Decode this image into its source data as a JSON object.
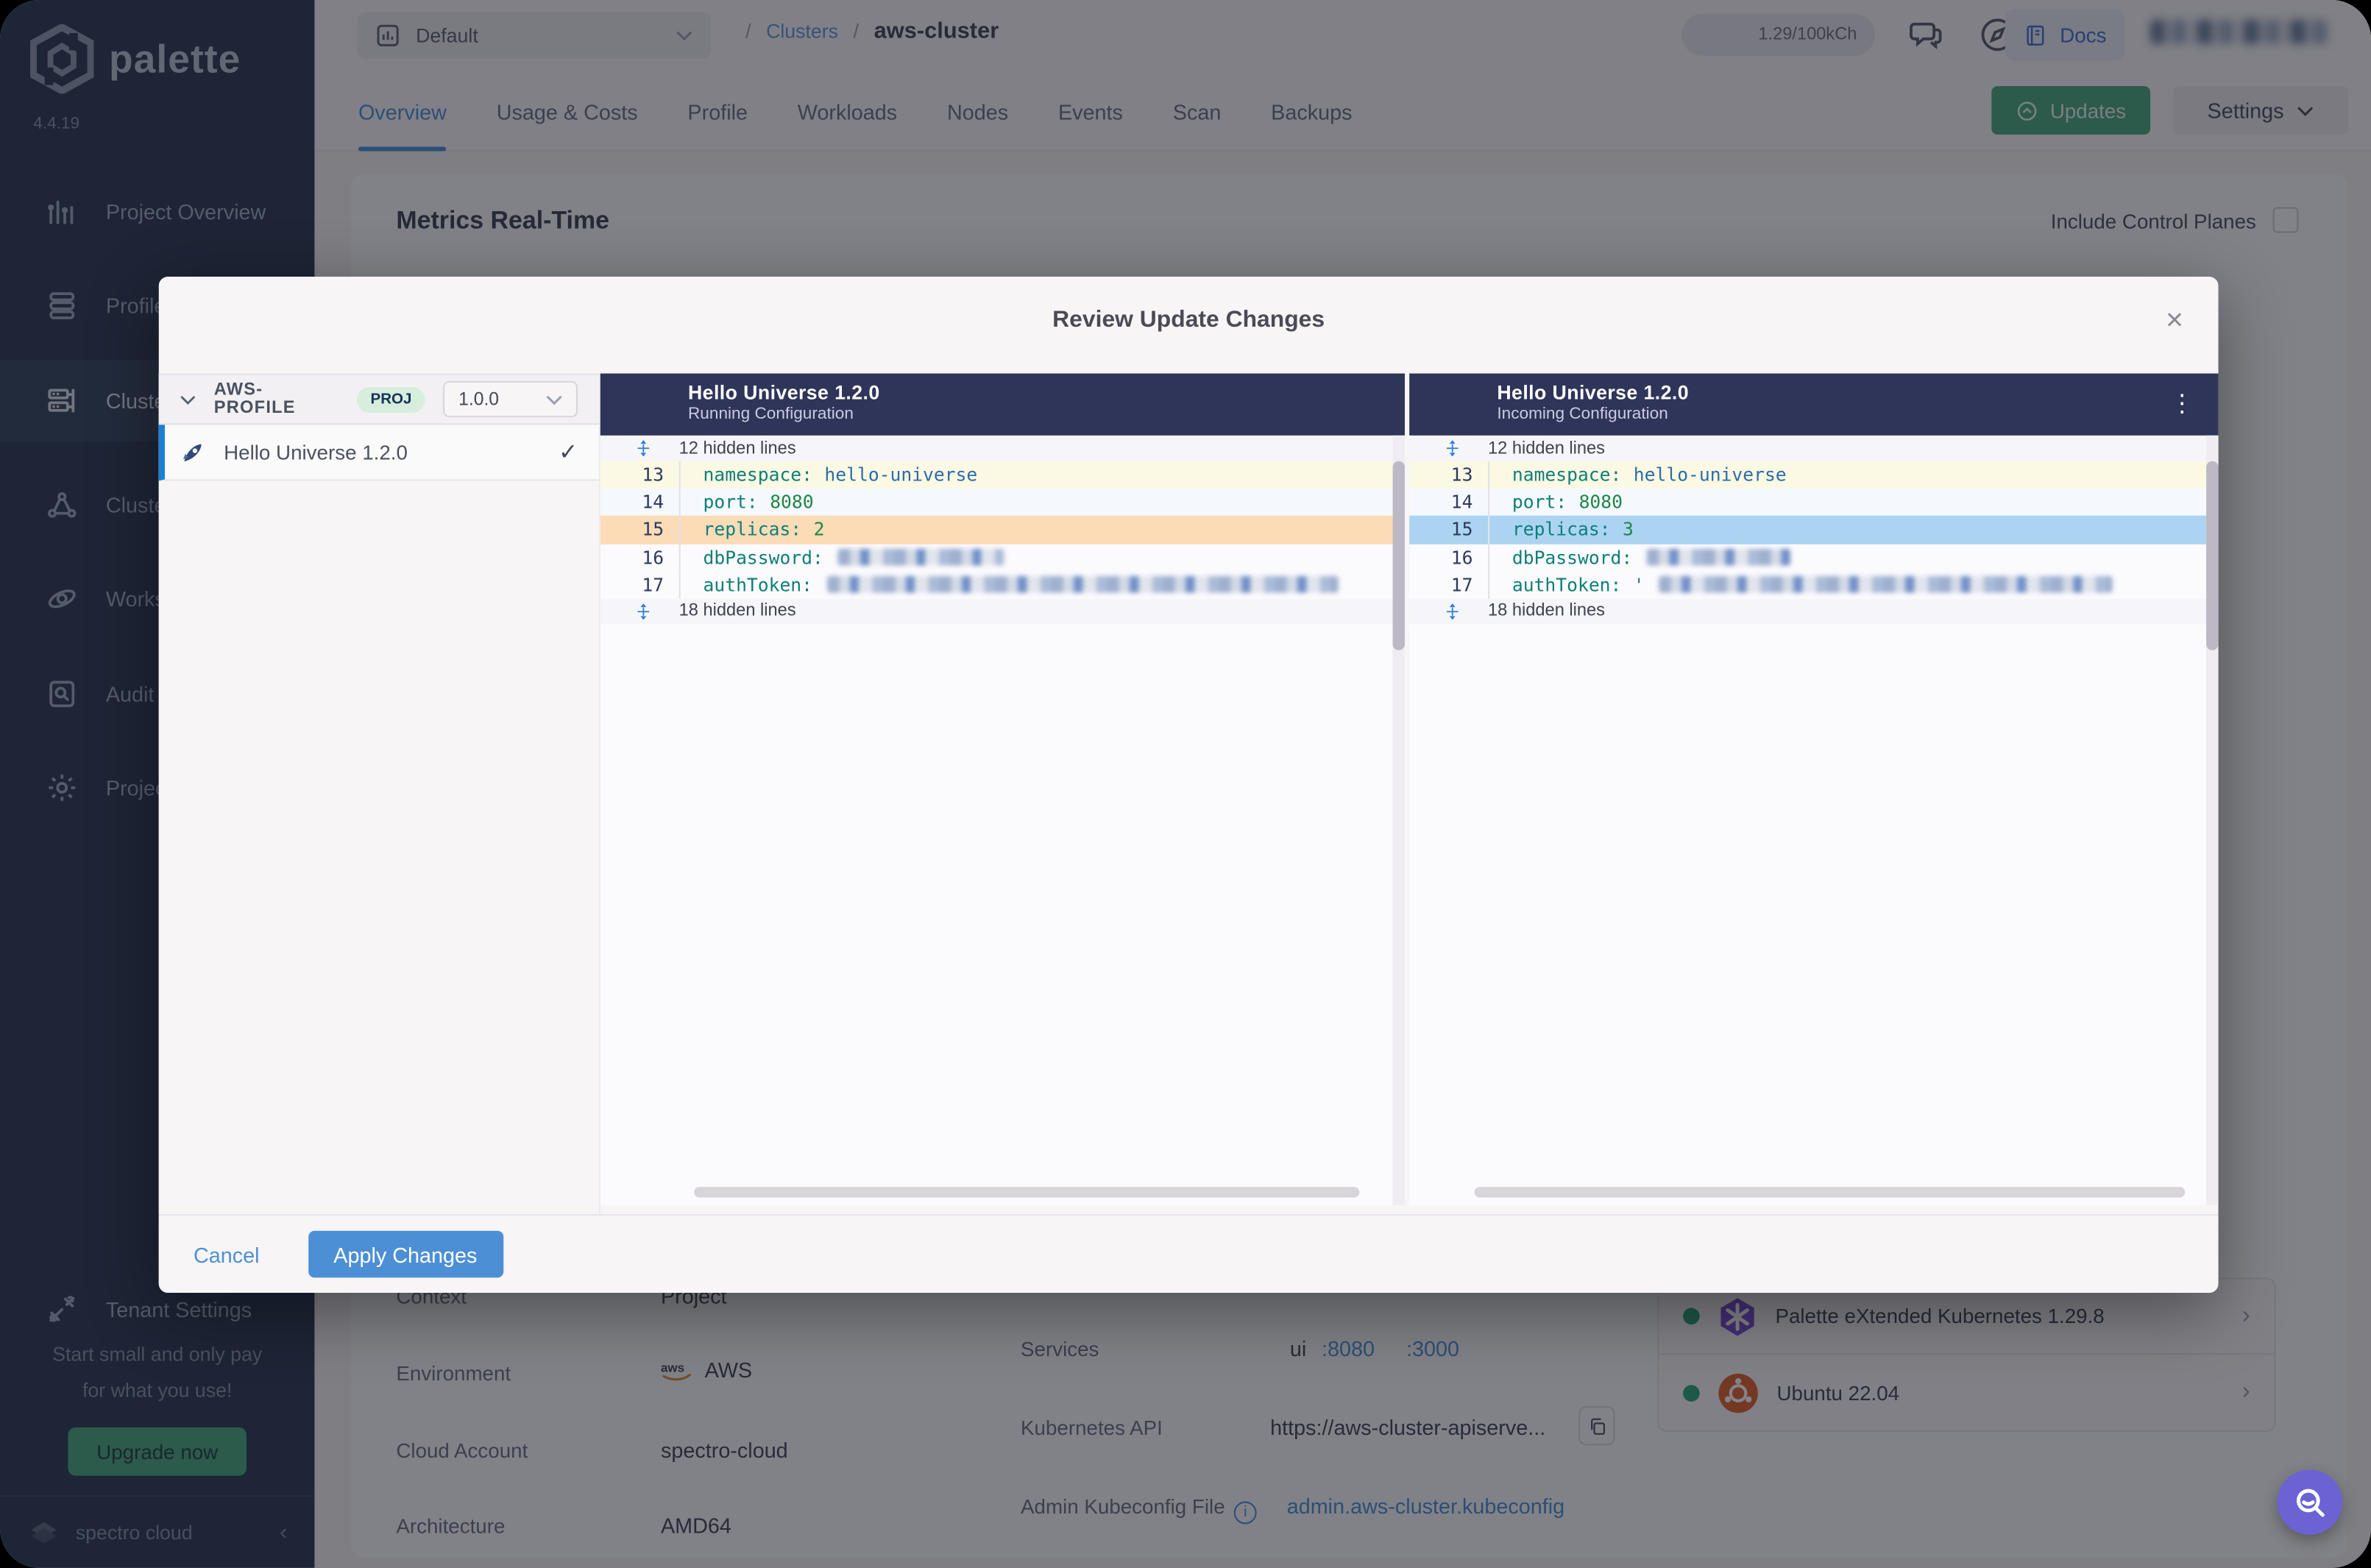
{
  "icons": {
    "close": "×",
    "check": "✓",
    "kebab": "⋮",
    "slash": "/",
    "collapse": "‹",
    "chevron_right": "›",
    "info": "i"
  },
  "colors": {
    "accent_blue": "#4d8fd5",
    "green": "#4aa87d",
    "diff_header_navy": "#2f3459",
    "changed_left": "#fbdcb7",
    "changed_right": "#abd4f2",
    "status_green": "#2ba577",
    "fab_purple": "#6b63d3"
  },
  "app": {
    "brand": "palette",
    "version": "4.4.19",
    "footer_brand": "spectro cloud"
  },
  "topbar": {
    "project_selector": "Default",
    "breadcrumb_section": "Clusters",
    "breadcrumb_current": "aws-cluster",
    "usage_badge": "1.29/100kCh",
    "docs_label": "Docs"
  },
  "tabs": [
    {
      "label": "Overview"
    },
    {
      "label": "Usage & Costs"
    },
    {
      "label": "Profile"
    },
    {
      "label": "Workloads"
    },
    {
      "label": "Nodes"
    },
    {
      "label": "Events"
    },
    {
      "label": "Scan"
    },
    {
      "label": "Backups"
    }
  ],
  "actions": {
    "updates": "Updates",
    "settings": "Settings"
  },
  "sidebar": {
    "items": [
      {
        "label": "Project Overview"
      },
      {
        "label": "Profiles"
      },
      {
        "label": "Clusters"
      },
      {
        "label": "Cluster Groups"
      },
      {
        "label": "Workspaces"
      },
      {
        "label": "Audit Logs"
      },
      {
        "label": "Project Settings"
      },
      {
        "label": "Tenant Settings"
      }
    ],
    "promo_line1": "Start small and only pay",
    "promo_line2": "for what you use!",
    "upgrade_label": "Upgrade now"
  },
  "main": {
    "metrics_title": "Metrics Real-Time",
    "include_control_planes": "Include Control Planes",
    "details": [
      {
        "label": "Context",
        "value": "Project"
      },
      {
        "label": "Environment",
        "value": "AWS"
      },
      {
        "label": "Cloud Account",
        "value": "spectro-cloud"
      },
      {
        "label": "Architecture",
        "value": "AMD64"
      }
    ],
    "services": {
      "label": "Services",
      "name": "ui",
      "port1": ":8080",
      "port2": ":3000"
    },
    "kubernetes_api": {
      "label": "Kubernetes API",
      "value": "https://aws-cluster-apiserve..."
    },
    "kubeconfig": {
      "label": "Admin Kubeconfig File",
      "value": "admin.aws-cluster.kubeconfig"
    },
    "layers": [
      {
        "name": "Palette eXtended Kubernetes 1.29.8"
      },
      {
        "name": "Ubuntu 22.04"
      }
    ]
  },
  "modal": {
    "title": "Review Update Changes",
    "profile": {
      "name": "AWS-PROFILE",
      "scope": "PROJ",
      "version": "1.0.0",
      "pack_name": "Hello Universe 1.2.0"
    },
    "diff": {
      "left_title": "Hello Universe 1.2.0",
      "left_subtitle": "Running Configuration",
      "right_title": "Hello Universe 1.2.0",
      "right_subtitle": "Incoming Configuration",
      "hidden_top": "12 hidden lines",
      "hidden_bottom": "18 hidden lines",
      "lines": [
        {
          "num": "13",
          "key": "namespace:",
          "value": "hello-universe"
        },
        {
          "num": "14",
          "key": "port:",
          "value": "8080"
        },
        {
          "num": "15",
          "key": "replicas:",
          "left_value": "2",
          "right_value": "3"
        },
        {
          "num": "16",
          "key": "dbPassword:"
        },
        {
          "num": "17",
          "key": "authToken:",
          "right_prefix": "'"
        }
      ]
    },
    "cancel_label": "Cancel",
    "apply_label": "Apply Changes"
  }
}
